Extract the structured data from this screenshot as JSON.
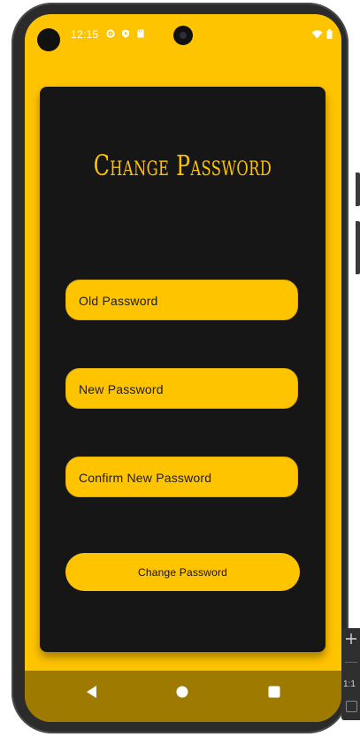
{
  "status_bar": {
    "time": "12:15",
    "left_icons": [
      "settings-icon",
      "shield-icon",
      "sd-card-icon"
    ],
    "right_icons": [
      "wifi-icon",
      "battery-icon"
    ]
  },
  "card": {
    "title": "Change Password",
    "fields": {
      "old_password": {
        "placeholder": "Old Password",
        "value": ""
      },
      "new_password": {
        "placeholder": "New Password",
        "value": ""
      },
      "confirm_password": {
        "placeholder": "Confirm New Password",
        "value": ""
      }
    },
    "submit_label": "Change Password"
  },
  "nav_bar": {
    "icons": [
      "back-icon",
      "home-icon",
      "recents-icon"
    ]
  },
  "emulator_controls": {
    "zoom_icon": "plus-icon",
    "ratio_label": "1:1",
    "fit_icon": "fit-screen-icon"
  },
  "colors": {
    "accent": "#FFC400",
    "card_background": "#161616",
    "nav_bar": "#9E7A00",
    "text_on_accent": "#1d1d1d"
  }
}
